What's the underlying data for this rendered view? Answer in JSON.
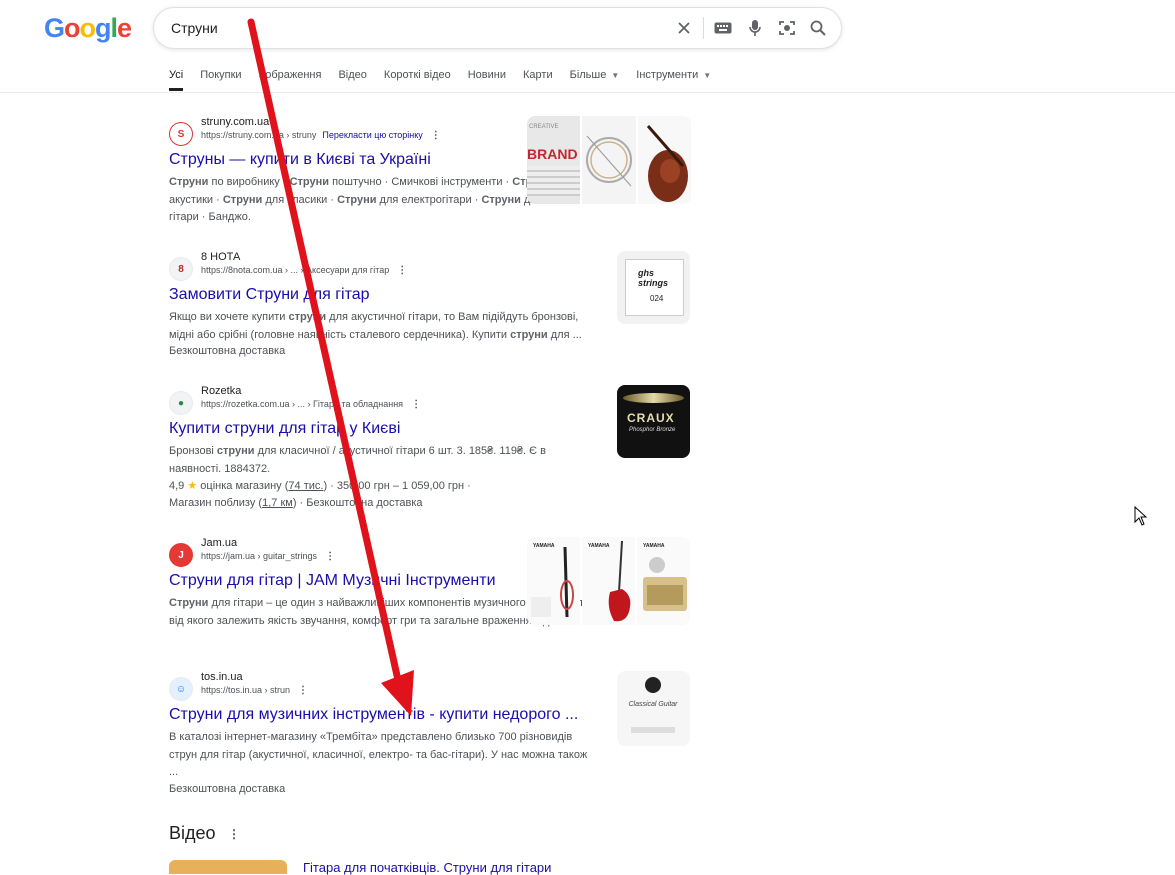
{
  "logo": {
    "text": "Google"
  },
  "search": {
    "query": "Струни"
  },
  "tabs": [
    {
      "label": "Усі"
    },
    {
      "label": "Покупки"
    },
    {
      "label": "Зображення"
    },
    {
      "label": "Відео"
    },
    {
      "label": "Короткі відео"
    },
    {
      "label": "Новини"
    },
    {
      "label": "Карти"
    },
    {
      "label": "Більше"
    },
    {
      "label": "Інструменти"
    }
  ],
  "results": [
    {
      "site": "struny.com.ua",
      "url": "https://struny.com.ua › struny",
      "translate": "Перекласти цю сторінку",
      "title": "Струны — купити в Києві та Україні",
      "snippet_html": "<b>Струни</b> по виробнику · <b>Струни</b> поштучно · Смичкові інструменти · <b>Струни</b> для акустики · <b>Струни</b> для класики · <b>Струни</b> для електрогітари · <b>Струни</b> для бас-гітари · Банджо."
    },
    {
      "site": "8 НОТА",
      "url": "https://8nota.com.ua › ... › Аксесуари для гітар",
      "title": "Замовити Струни для гітар",
      "snippet_html": "Якщо ви хочете купити <b>струни</b> для акустичної гітари, то Вам підійдуть бронзові, мідні або срібні (головне наявність сталевого сердечника). Купити <b>струни</b> для ...",
      "extra1": "Безкоштовна доставка"
    },
    {
      "site": "Rozetka",
      "url": "https://rozetka.com.ua › ... › Гітари та обладнання",
      "title": "Купити струни для гітар у Києві",
      "snippet_html": "Бронзові <b>струни</b> для класичної / акустичної гітари 6 шт. 3. 185₴. 119₴. Є в наявності. 1884372.",
      "rating": "4,9",
      "rating_label": "оцінка магазину",
      "rating_count": "74 тис.",
      "price_range": "350,00 грн – 1 059,00 грн",
      "store_nearby": "Магазин поблизу",
      "distance": "1,7 км",
      "free_delivery": "Безкоштовна доставка"
    },
    {
      "site": "Jam.ua",
      "url": "https://jam.ua › guitar_strings",
      "title": "Струни для гітар | JAM Музичні Інструменти",
      "snippet_html": "<b>Струни</b> для гітари – це один з найважливіших компонентів музичного інструменту, від якого залежить якість звучання, комфорт гри та загальне враження від ..."
    },
    {
      "site": "tos.in.ua",
      "url": "https://tos.in.ua › strun",
      "title": "Струни для музичних інструментів - купити недорого ...",
      "snippet_html": "В каталозі інтернет-магазину «Трембіта» представлено близько 700 різновидів струн для гітар (акустичної, класичної, електро- та бас-гітари). У нас можна також ...",
      "extra1": "Безкоштовна доставка"
    }
  ],
  "video_section": {
    "heading": "Відео",
    "first_title": "Гітара для початківців. Струни для гітари"
  },
  "thumb_text": {
    "brand": "BRAND",
    "brand_small": "CREATIVE",
    "ghs": "ghs strings",
    "ghs_num": "024",
    "craux": "CRAUX",
    "craux_sub": "Phosphor Bronze",
    "yamaha": "YAMAHA",
    "classical": "Classical Guitar"
  },
  "colors": {
    "link": "#1a0dab",
    "annotation_arrow": "#e0121b"
  }
}
